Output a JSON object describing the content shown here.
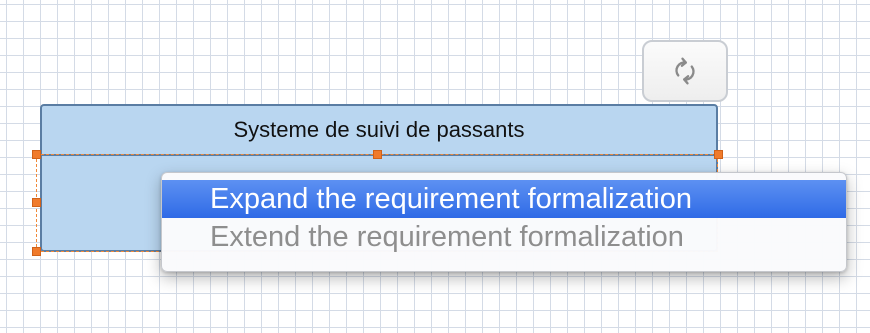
{
  "diagram": {
    "class_box": {
      "title": "Systeme de suivi de passants",
      "selected": true
    },
    "refresh_button": {
      "icon": "refresh-arrows-icon"
    }
  },
  "context_menu": {
    "items": [
      {
        "label": "Expand the requirement formalization",
        "state": "highlighted"
      },
      {
        "label": "Extend the requirement formalization",
        "state": "disabled"
      }
    ]
  },
  "colors": {
    "class_fill": "#b9d6f0",
    "class_border": "#5a7da3",
    "selection_handle": "#f07b2c",
    "menu_highlight": "#3b78ea",
    "grid_line": "#d4dbe6"
  }
}
